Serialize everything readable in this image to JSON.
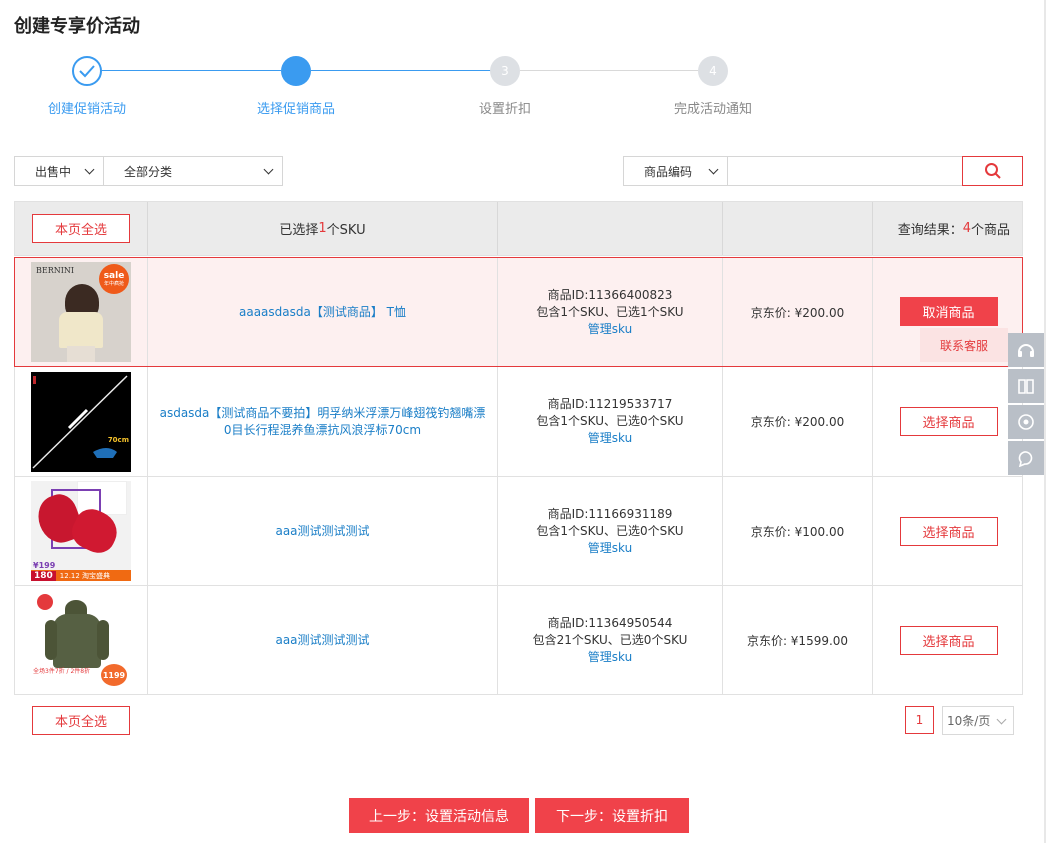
{
  "page": {
    "title": "创建专享价活动"
  },
  "steps": [
    {
      "num": "",
      "label": "创建促销活动",
      "state": "done"
    },
    {
      "num": "",
      "label": "选择促销商品",
      "state": "active"
    },
    {
      "num": "3",
      "label": "设置折扣",
      "state": "todo"
    },
    {
      "num": "4",
      "label": "完成活动通知",
      "state": "todo"
    }
  ],
  "filters": {
    "status": "出售中",
    "category": "全部分类",
    "search_type": "商品编码",
    "search_value": ""
  },
  "table": {
    "select_all_label": "本页全选",
    "selected_prefix": "已选择",
    "selected_count": "1",
    "selected_suffix": "个SKU",
    "result_prefix": "查询结果：",
    "result_count": "4",
    "result_suffix": "个商品",
    "rows": [
      {
        "name": "aaaasdasda【测试商品】 T恤",
        "id_text": "商品ID:11366400823",
        "sku_text": "包含1个SKU、已选1个SKU",
        "manage": "管理sku",
        "price": "京东价: ¥200.00",
        "action": "取消商品",
        "selected": true,
        "thumb": {
          "brand": "BERNINI",
          "badge_title": "sale",
          "badge_sub": "年中疯抢"
        }
      },
      {
        "name": "asdasda【测试商品不要拍】明孚纳米浮漂万峰翅筏钓翘嘴漂0目长行程混养鱼漂抗风浪浮标70cm",
        "id_text": "商品ID:11219533717",
        "sku_text": "包含1个SKU、已选0个SKU",
        "manage": "管理sku",
        "price": "京东价: ¥200.00",
        "action": "选择商品",
        "selected": false,
        "thumb": {
          "corner": "70cm"
        }
      },
      {
        "name": "aaa测试测试测试",
        "id_text": "商品ID:11166931189",
        "sku_text": "包含1个SKU、已选0个SKU",
        "manage": "管理sku",
        "price": "京东价: ¥100.00",
        "action": "选择商品",
        "selected": false,
        "thumb": {
          "price_a": "¥199",
          "price_b": "180",
          "promo": "12.12 淘宝盛典"
        }
      },
      {
        "name": "aaa测试测试测试",
        "id_text": "商品ID:11364950544",
        "sku_text": "包含21个SKU、已选0个SKU",
        "manage": "管理sku",
        "price": "京东价: ¥1599.00",
        "action": "选择商品",
        "selected": false,
        "thumb": {
          "tag": "全场3件7折 / 2件8折",
          "price": "1199"
        }
      }
    ]
  },
  "floating": {
    "tooltip": "联系客服"
  },
  "pagination": {
    "current": "1",
    "page_size": "10条/页"
  },
  "footer": {
    "prev": "上一步：设置活动信息",
    "next": "下一步：设置折扣"
  },
  "colors": {
    "brand_red": "#e4393c",
    "step_blue": "#3a9bf0",
    "link_blue": "#1a7ec7",
    "selected_row_bg": "#fdf0f0"
  },
  "icons": [
    "check-icon",
    "search-icon",
    "chevron-down-icon",
    "headset-icon",
    "book-icon",
    "play-icon",
    "chat-icon"
  ]
}
